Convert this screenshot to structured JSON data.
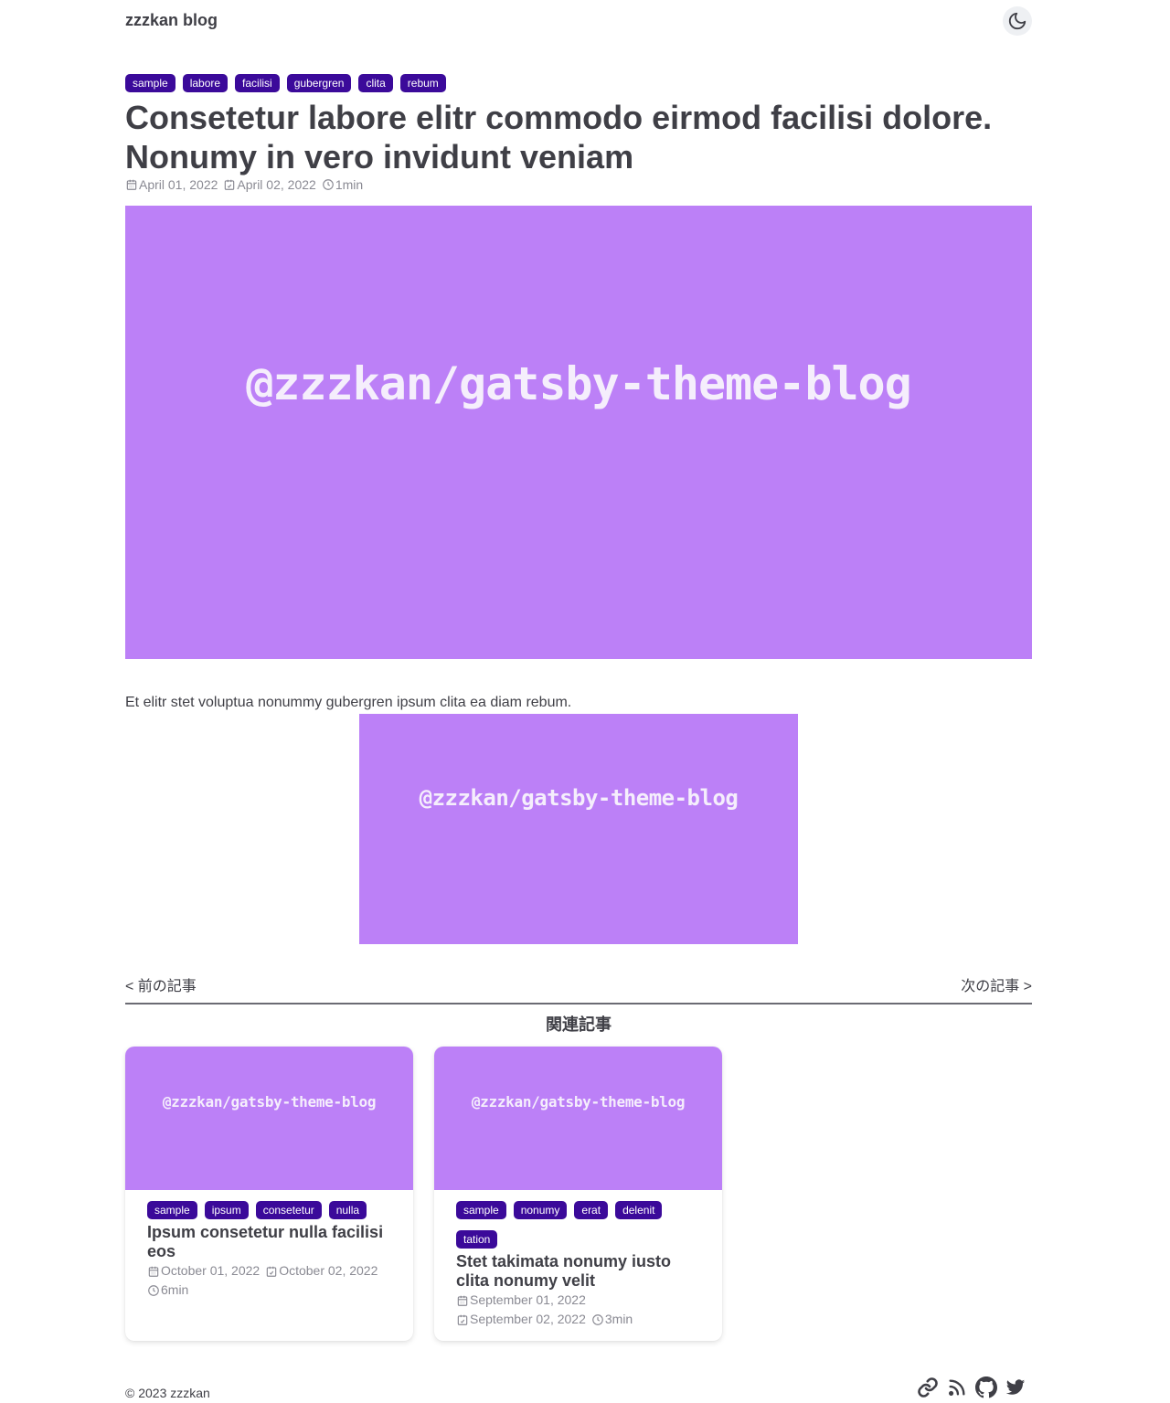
{
  "site": {
    "title": "zzzkan blog"
  },
  "post": {
    "tags": [
      "sample",
      "labore",
      "facilisi",
      "gubergren",
      "clita",
      "rebum"
    ],
    "title": "Consetetur labore elitr commodo eirmod facilisi dolore. Nonumy in vero invidunt veniam",
    "published": "April 01, 2022",
    "updated": "April 02, 2022",
    "read_time": "1min",
    "hero_text": "@zzzkan/gatsby-theme-blog",
    "body": "Et elitr stet voluptua nonummy gubergren ipsum clita ea diam rebum.",
    "inline_image_text": "@zzzkan/gatsby-theme-blog"
  },
  "pager": {
    "prev": "< 前の記事",
    "next": "次の記事 >"
  },
  "related": {
    "heading": "関連記事",
    "cards": [
      {
        "image_text": "@zzzkan/gatsby-theme-blog",
        "tags": [
          "sample",
          "ipsum",
          "consetetur",
          "nulla"
        ],
        "title": "Ipsum consetetur nulla facilisi eos",
        "published": "October 01, 2022",
        "updated": "October 02, 2022",
        "read_time": "6min"
      },
      {
        "image_text": "@zzzkan/gatsby-theme-blog",
        "tags": [
          "sample",
          "nonumy",
          "erat",
          "delenit",
          "tation"
        ],
        "title": "Stet takimata nonumy iusto clita nonumy velit",
        "published": "September 01, 2022",
        "updated": "September 02, 2022",
        "read_time": "3min"
      }
    ]
  },
  "footer": {
    "copyright": "© 2023 zzzkan",
    "icons": [
      "link-icon",
      "rss-icon",
      "github-icon",
      "twitter-icon"
    ]
  },
  "colors": {
    "accent_tag": "#3b0a9a",
    "image_bg": "#bc80f7",
    "text": "#3f3f46",
    "muted": "#8a8a93"
  }
}
